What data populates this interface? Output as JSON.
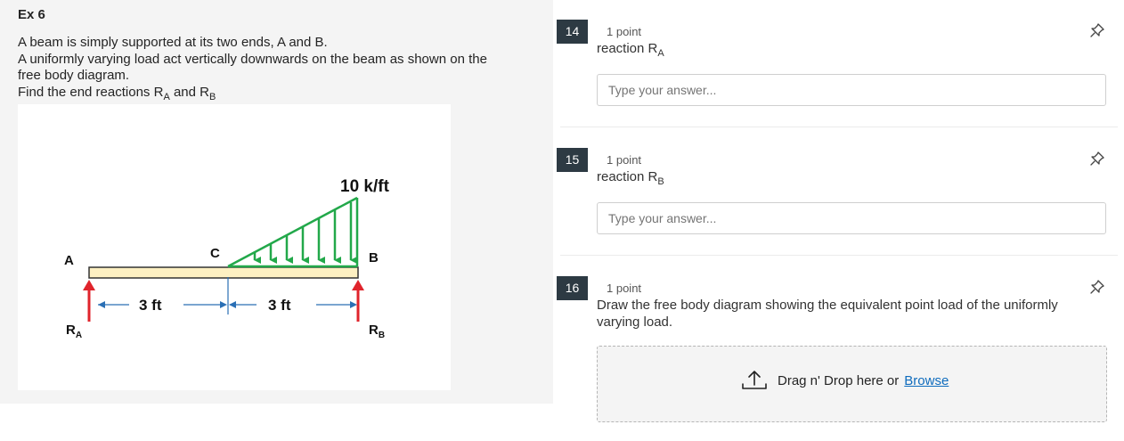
{
  "exercise": {
    "title": "Ex 6",
    "lines": [
      "A beam is simply supported at its two ends, A and B.",
      "A uniformly varying load act vertically downwards on the beam as shown on the",
      "free body diagram.",
      "Find the end reactions "
    ],
    "ra_main": "R",
    "ra_sub": "A",
    "and": " and ",
    "rb_main": "R",
    "rb_sub": "B"
  },
  "diagram": {
    "load_label": "10 k/ft",
    "point_a": "A",
    "point_b": "B",
    "point_c": "C",
    "dim_1": "3 ft",
    "dim_2": "3 ft",
    "ra_main": "R",
    "ra_sub": "A",
    "rb_main": "R",
    "rb_sub": "B",
    "colors": {
      "beam": "#fdf0c2",
      "load": "#22a84a",
      "reaction": "#e0242c"
    }
  },
  "questions": [
    {
      "number": "14",
      "points": "1 point",
      "text_main": "reaction R",
      "text_sub": "A",
      "placeholder": "Type your answer..."
    },
    {
      "number": "15",
      "points": "1 point",
      "text_main": "reaction R",
      "text_sub": "B",
      "placeholder": "Type your answer..."
    },
    {
      "number": "16",
      "points": "1 point",
      "text_line1": "Draw the free body diagram showing the equivalent point load of the uniformly",
      "text_line2": "varying load.",
      "upload_text": "Drag n' Drop here or",
      "browse": "Browse"
    }
  ],
  "icons": {
    "pin": "pin-icon",
    "upload": "upload-icon"
  }
}
